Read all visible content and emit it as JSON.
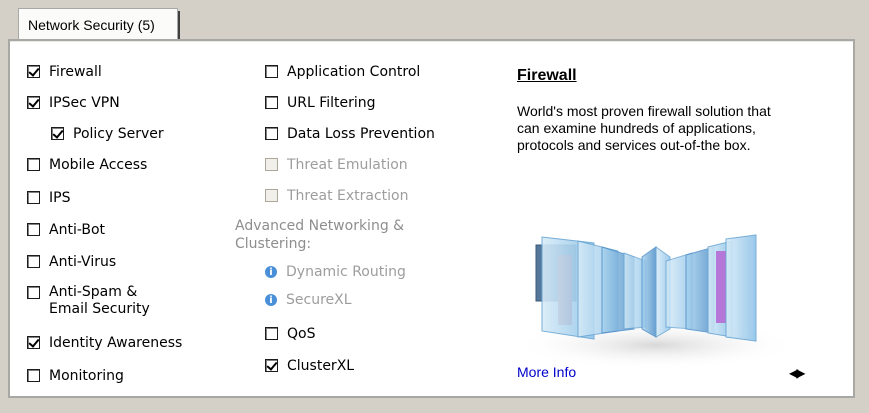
{
  "tab": {
    "label": "Network Security (5)"
  },
  "left_column": [
    {
      "label": "Firewall",
      "checked": true,
      "disabled": false
    },
    {
      "label": "IPSec VPN",
      "checked": true,
      "disabled": false
    },
    {
      "label": "Policy Server",
      "checked": true,
      "disabled": false
    },
    {
      "label": "Mobile Access",
      "checked": false,
      "disabled": false
    },
    {
      "label": "IPS",
      "checked": false,
      "disabled": false
    },
    {
      "label": "Anti-Bot",
      "checked": false,
      "disabled": false
    },
    {
      "label": "Anti-Virus",
      "checked": false,
      "disabled": false
    },
    {
      "label": "Anti-Spam &\nEmail Security",
      "checked": false,
      "disabled": false
    },
    {
      "label": "Identity Awareness",
      "checked": true,
      "disabled": false
    },
    {
      "label": "Monitoring",
      "checked": false,
      "disabled": false
    }
  ],
  "middle_column": [
    {
      "label": "Application Control",
      "checked": false,
      "disabled": false
    },
    {
      "label": "URL Filtering",
      "checked": false,
      "disabled": false
    },
    {
      "label": "Data Loss Prevention",
      "checked": false,
      "disabled": false
    },
    {
      "label": "Threat Emulation",
      "checked": false,
      "disabled": true
    },
    {
      "label": "Threat Extraction",
      "checked": false,
      "disabled": true
    }
  ],
  "advanced": {
    "heading": "Advanced Networking &\nClustering:",
    "info_items": [
      {
        "label": "Dynamic Routing",
        "icon": "info-icon"
      },
      {
        "label": "SecureXL",
        "icon": "info-icon"
      }
    ],
    "checkbox_items": [
      {
        "label": "QoS",
        "checked": false,
        "disabled": false
      },
      {
        "label": "ClusterXL",
        "checked": true,
        "disabled": false
      }
    ]
  },
  "detail": {
    "title": "Firewall",
    "description": "World's most proven firewall solution that can examine hundreds of applications, protocols and services out-of-the box.",
    "more_info": "More Info",
    "nav_icon": "left-right-arrows-icon"
  },
  "colors": {
    "background": "#d4d0c8",
    "panel": "#ffffff",
    "link": "#0000cc",
    "disabled_text": "#9d9d9d"
  }
}
